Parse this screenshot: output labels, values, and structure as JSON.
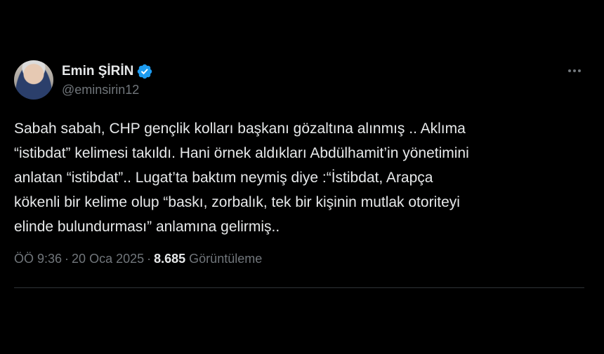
{
  "tweet": {
    "display_name": "Emin ŞİRİN",
    "handle": "@eminsirin12",
    "verified_color": "#1d9bf0",
    "more_icon": "more-horizontal-icon",
    "text": "Sabah sabah, CHP gençlik kolları başkanı gözaltına alınmış .. Aklıma\n“istibdat” kelimesi takıldı. Hani örnek aldıkları Abdülhamit’in yönetimini\nanlatan “istibdat”.. Lugat’ta baktım neymiş diye :“İstibdat, Arapça\nkökenli bir kelime olup “baskı, zorbalık, tek bir kişinin mutlak otoriteyi\nelinde bulundurması” anlamına gelirmiş..",
    "time": "ÖÖ 9:36",
    "date": "20 Oca 2025",
    "separator": "·",
    "views_count": "8.685",
    "views_label": "Görüntüleme"
  }
}
